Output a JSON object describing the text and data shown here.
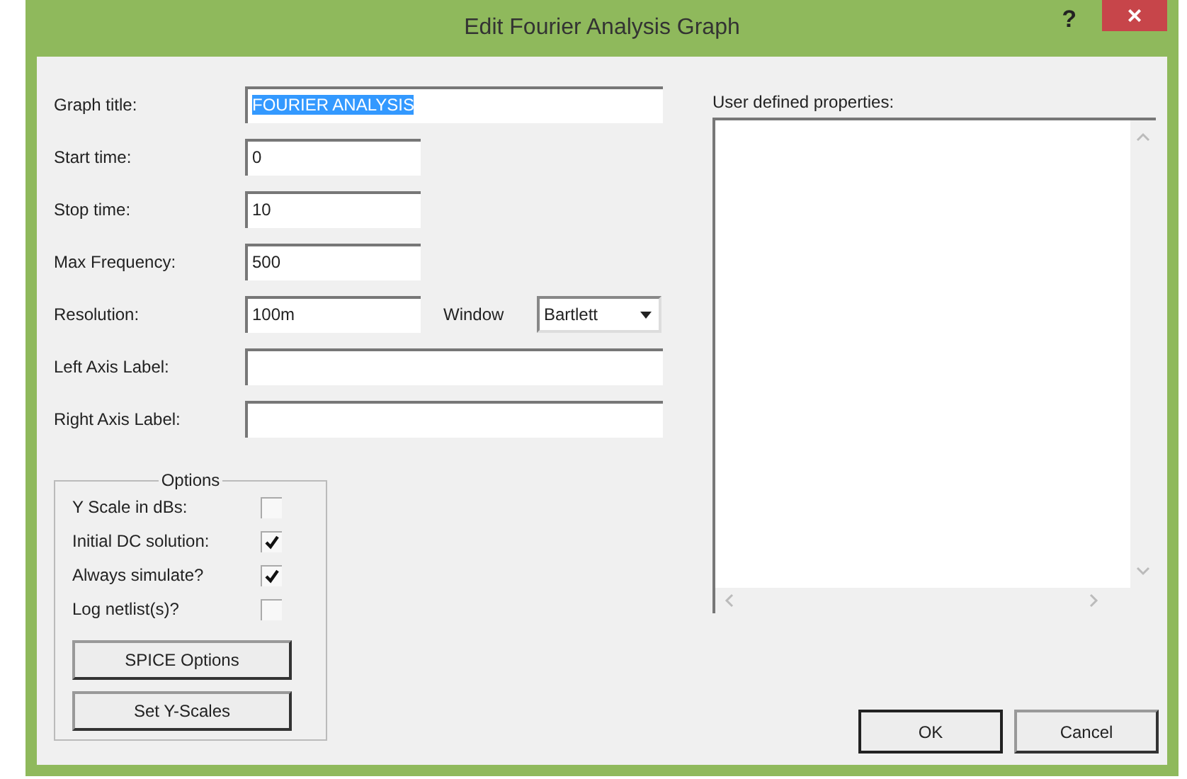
{
  "window": {
    "title": "Edit Fourier Analysis Graph",
    "help": "?",
    "close": "×"
  },
  "fields": [
    {
      "label": "Graph title:",
      "value": "FOURIER ANALYSIS",
      "kind": "wide",
      "text_selected": true
    },
    {
      "label": "Start time:",
      "value": "0",
      "kind": "short"
    },
    {
      "label": "Stop time:",
      "value": "10",
      "kind": "short"
    },
    {
      "label": "Max Frequency:",
      "value": "500",
      "kind": "short"
    },
    {
      "label": "Resolution:",
      "value": "100m",
      "kind": "window",
      "window_label": "Window",
      "window_value": "Bartlett"
    },
    {
      "label": "Left Axis Label:",
      "kind": "wide"
    },
    {
      "label": "Right Axis Label:",
      "kind": "wide"
    }
  ],
  "options": {
    "title": "Options",
    "checks": [
      {
        "label": "Y Scale in dBs:",
        "checked": false
      },
      {
        "label": "Initial DC solution:",
        "checked": true
      },
      {
        "label": "Always simulate?",
        "checked": true
      },
      {
        "label": "Log netlist(s)?",
        "checked": false
      }
    ],
    "buttons": [
      "SPICE Options",
      "Set Y-Scales"
    ]
  },
  "properties": {
    "label": "User defined properties:"
  },
  "buttons": [
    "OK",
    "Cancel"
  ]
}
